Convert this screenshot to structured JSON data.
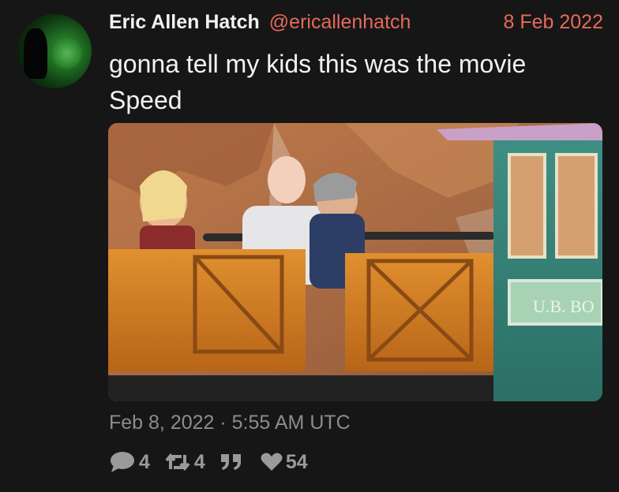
{
  "author": {
    "display_name": "Eric Allen Hatch",
    "handle": "@ericallenhatch",
    "date": "8 Feb 2022"
  },
  "tweet": {
    "text_line1": "gonna tell my kids this was the movie",
    "text_line2": "Speed",
    "image_sign_text": "U.B. BO",
    "timestamp": "Feb 8, 2022 · 5:55 AM UTC"
  },
  "stats": {
    "replies": "4",
    "retweets": "4",
    "quotes": "",
    "likes": "54"
  },
  "colors": {
    "background": "#161616",
    "accent": "#e56a5a",
    "muted": "#8c8c8c"
  },
  "icons": [
    "comment-icon",
    "retweet-icon",
    "quote-icon",
    "heart-icon"
  ]
}
